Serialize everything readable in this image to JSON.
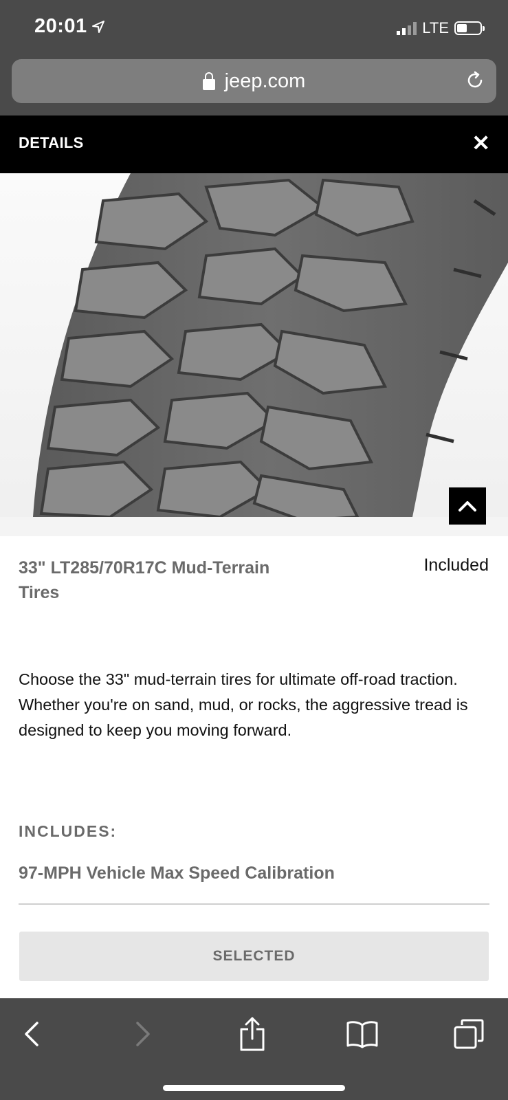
{
  "status_bar": {
    "time": "20:01",
    "network": "LTE"
  },
  "browser": {
    "url": "jeep.com"
  },
  "details_header": {
    "title": "DETAILS"
  },
  "product": {
    "name": "33\" LT285/70R17C Mud-Terrain Tires",
    "price_status": "Included",
    "description": "Choose the 33\" mud-terrain tires for ultimate off-road traction.  Whether you're on sand, mud, or rocks, the aggressive tread is designed to keep you moving forward.",
    "includes_label": "INCLUDES:",
    "includes_items": [
      "97-MPH Vehicle Max Speed Calibration"
    ],
    "button_label": "SELECTED"
  },
  "colors": {
    "chrome": "#4a4a4a",
    "header": "#000000",
    "muted_text": "#6a6a6a"
  }
}
